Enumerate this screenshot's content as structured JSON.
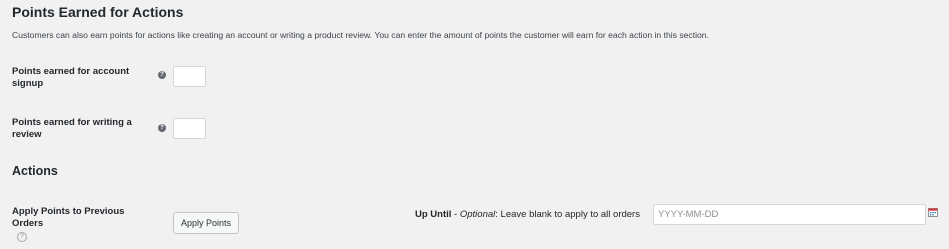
{
  "points_section": {
    "title": "Points Earned for Actions",
    "description": "Customers can also earn points for actions like creating an account or writing a product review. You can enter the amount of points the customer will earn for each action in this section.",
    "fields": [
      {
        "label": "Points earned for account signup",
        "value": ""
      },
      {
        "label": "Points earned for writing a review",
        "value": ""
      }
    ],
    "help_glyph": "?"
  },
  "actions_section": {
    "title": "Actions",
    "apply_previous": {
      "label": "Apply Points to Previous Orders",
      "help_glyph": "?",
      "button_label": "Apply Points"
    },
    "up_until": {
      "label_bold": "Up Until",
      "dash": " - ",
      "label_italic": "Optional",
      "label_rest": ": Leave blank to apply to all orders",
      "placeholder": "YYYY-MM-DD",
      "value": ""
    }
  },
  "icons": {
    "help": "question-circle-icon",
    "calendar": "calendar-icon"
  },
  "colors": {
    "background": "#f1f1f1",
    "text": "#23282d",
    "help_icon": "#646970",
    "calendar_accent": "#d63638"
  }
}
